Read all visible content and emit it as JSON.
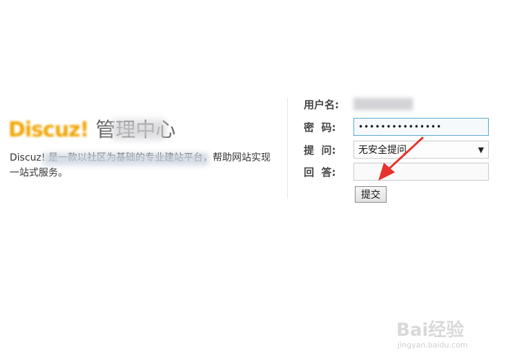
{
  "intro": {
    "brand": "Discuz!",
    "title_suffix": "管理中心",
    "description": "Discuz! 是一款以社区为基础的专业建站平台，帮助网站实现一站式服务。"
  },
  "form": {
    "username_label": "用户名:",
    "password_label": "密  码:",
    "password_value": "•••••••••••••••",
    "question_label": "提  问:",
    "question_selected": "无安全提问",
    "answer_label": "回  答:",
    "answer_value": "",
    "submit_label": "提交"
  },
  "annotation": {
    "arrow_color": "#e8322c"
  },
  "watermark": {
    "text": "Bai经验",
    "sub": "jingyan.baidu.com"
  }
}
